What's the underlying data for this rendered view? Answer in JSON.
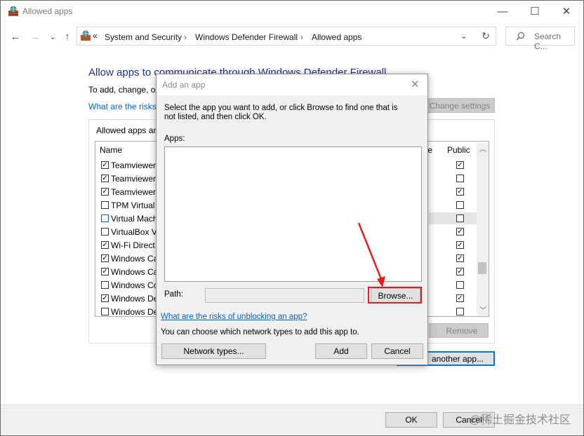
{
  "window": {
    "title": "Allowed apps",
    "app_icon": "firewall-app-icon",
    "minimize": "—",
    "maximize": "☐",
    "close": "✕"
  },
  "nav": {
    "back": "←",
    "forward": "→",
    "recent": "⌄",
    "up": "↑"
  },
  "address": {
    "chevrons": "«",
    "crumbs": [
      "System and Security",
      "Windows Defender Firewall",
      "Allowed apps"
    ],
    "sep": "›",
    "dropdown": "⌄",
    "refresh": "↻"
  },
  "search": {
    "placeholder": "Search C...",
    "icon": "search-icon"
  },
  "main": {
    "heading": "Allow apps to communicate through Windows Defender Firewall",
    "subtext": "To add, change, or",
    "risks_link": "What are the risks",
    "change_settings": "Change settings",
    "list_label": "Allowed apps an",
    "col_name": "Name",
    "col_private": "te",
    "col_public": "Public",
    "rows": [
      {
        "name": "Teamviewer",
        "checked": true,
        "public": true
      },
      {
        "name": "Teamviewer",
        "checked": true,
        "public": false
      },
      {
        "name": "Teamviewer",
        "checked": true,
        "public": true
      },
      {
        "name": "TPM Virtual",
        "checked": false,
        "public": false
      },
      {
        "name": "Virtual Mach",
        "checked": false,
        "public": false
      },
      {
        "name": "VirtualBox V",
        "checked": false,
        "public": true
      },
      {
        "name": "Wi-Fi Direct",
        "checked": true,
        "public": true
      },
      {
        "name": "Windows Ca",
        "checked": true,
        "public": true
      },
      {
        "name": "Windows Ca",
        "checked": true,
        "public": true
      },
      {
        "name": "Windows Co",
        "checked": false,
        "public": false
      },
      {
        "name": "Windows De",
        "checked": true,
        "public": true
      },
      {
        "name": "Windows De",
        "checked": false,
        "public": false
      }
    ],
    "remove": "Remove",
    "allow_another": "another app..."
  },
  "footer": {
    "ok": "OK",
    "cancel": "Cancel"
  },
  "watermark": "@稀土掘金技术社区",
  "dialog": {
    "title": "Add an app",
    "close": "✕",
    "instruction": "Select the app you want to add, or click Browse to find one that is not listed, and then click OK.",
    "apps_label": "Apps:",
    "path_label": "Path:",
    "path_value": "",
    "browse": "Browse...",
    "risks_link": "What are the risks of unblocking an app?",
    "network_note": "You can choose which network types to add this app to.",
    "network_types": "Network types...",
    "add": "Add",
    "cancel": "Cancel"
  },
  "annotation": {
    "color": "#e02020"
  }
}
